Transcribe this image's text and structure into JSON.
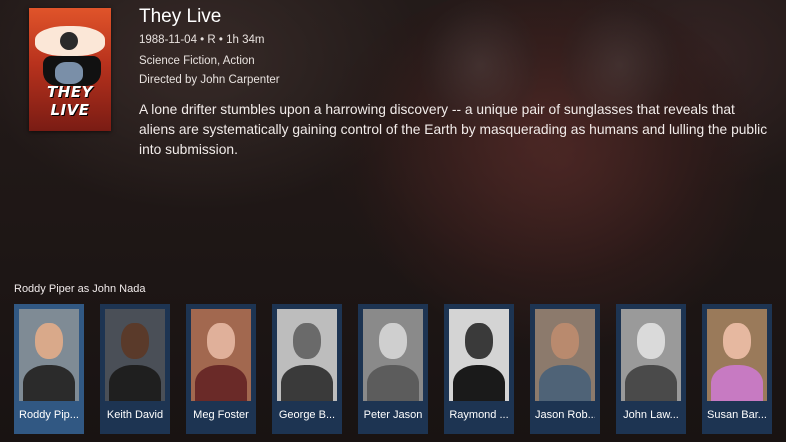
{
  "movie": {
    "title": "They Live",
    "date_rating_runtime": "1988-11-04 • R • 1h 34m",
    "genres": "Science Fiction, Action",
    "director": "Directed by John Carpenter",
    "description": "A lone drifter stumbles upon a harrowing discovery -- a unique pair of sunglasses that reveals that aliens are systematically gaining control of the Earth by masquerading as humans and lulling the public into submission.",
    "poster_title": "THEY LIVE"
  },
  "cast": {
    "selected_caption": "Roddy Piper as John Nada",
    "members": [
      {
        "name": "Roddy Pip..."
      },
      {
        "name": "Keith David"
      },
      {
        "name": "Meg Foster"
      },
      {
        "name": "George B..."
      },
      {
        "name": "Peter Jason"
      },
      {
        "name": "Raymond ..."
      },
      {
        "name": "Jason Rob..."
      },
      {
        "name": "John Law..."
      },
      {
        "name": "Susan Bar..."
      }
    ],
    "selected_index": 0
  },
  "colors": {
    "card_background": "#1d3452",
    "card_selected": "#315883",
    "poster_red": "#c8381f"
  }
}
